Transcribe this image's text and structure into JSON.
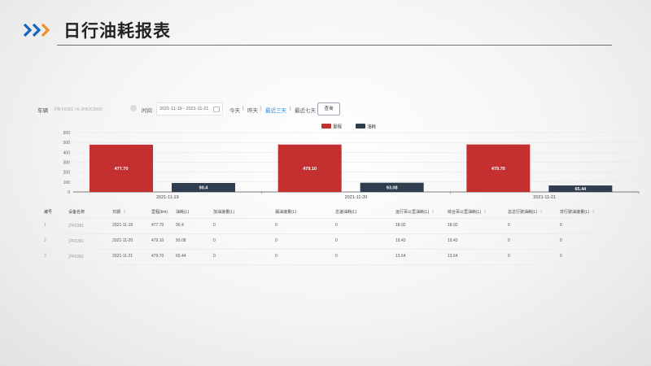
{
  "header": {
    "title": "日行油耗报表",
    "accent_colors": [
      "#1565c0",
      "#f28c28"
    ]
  },
  "filter": {
    "vehicle_label": "车辆",
    "vehicle_value": "沪B·F6361 / A·2FB2C0000",
    "time_label": "时间",
    "time_range": "2021-11-19 - 2021-11-21",
    "quick": [
      "今天",
      "昨天",
      "最近三天",
      "最近七天"
    ],
    "active_quick": "最近三天",
    "separator": "|",
    "query_label": "查询"
  },
  "chart_data": {
    "type": "bar",
    "categories": [
      "2021-11-19",
      "2021-11-20",
      "2021-11-21"
    ],
    "series": [
      {
        "name": "里程",
        "color": "#c43030",
        "values": [
          477.7,
          479.1,
          479.7
        ],
        "labels": [
          "477.70",
          "479.10",
          "479.70"
        ]
      },
      {
        "name": "油耗",
        "color": "#2e3e4e",
        "values": [
          90.4,
          93.08,
          65.44
        ],
        "labels": [
          "90.4",
          "93.08",
          "65.44"
        ]
      }
    ],
    "ylim": [
      0,
      600
    ],
    "yticks": [
      0,
      100,
      200,
      300,
      400,
      500,
      600
    ],
    "grid": true,
    "legend": "top-center"
  },
  "table": {
    "headers": [
      "编号",
      "设备名称",
      "日期",
      "里程(km)",
      "油耗(L)",
      "加油速量(L)",
      "漏油速量(L)",
      "怠速油耗(L)",
      "运行百公里油耗(L)",
      "综合百公里油耗(L)",
      "总怠行驶油耗(L)",
      "非行驶油速量(L)"
    ],
    "sort_mark": "⇕",
    "rows": [
      [
        "1",
        "沪F6361",
        "2021-11-19",
        "477.70",
        "90.4",
        "0",
        "0",
        "0",
        "18.92",
        "18.92",
        "0",
        "0"
      ],
      [
        "2",
        "沪F6361",
        "2021-11-20",
        "479.10",
        "93.08",
        "0",
        "0",
        "0",
        "19.42",
        "19.42",
        "0",
        "0"
      ],
      [
        "3",
        "沪F6361",
        "2021-11-21",
        "479.70",
        "65.44",
        "0",
        "0",
        "0",
        "13.64",
        "13.64",
        "0",
        "0"
      ]
    ]
  }
}
